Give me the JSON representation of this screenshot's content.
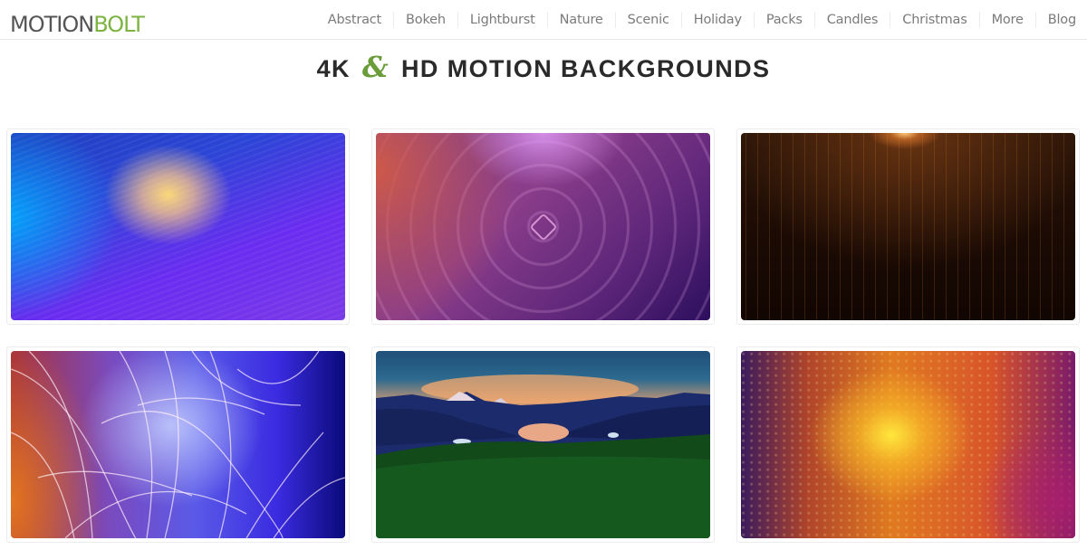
{
  "brand": {
    "logo_part1": "MOTION",
    "logo_part2": "BOLT",
    "accent_color": "#7cb342"
  },
  "nav": {
    "items": [
      {
        "label": "Abstract"
      },
      {
        "label": "Bokeh"
      },
      {
        "label": "Lightburst"
      },
      {
        "label": "Nature"
      },
      {
        "label": "Scenic"
      },
      {
        "label": "Holiday"
      },
      {
        "label": "Packs"
      },
      {
        "label": "Candles"
      },
      {
        "label": "Christmas"
      },
      {
        "label": "More"
      },
      {
        "label": "Blog"
      }
    ]
  },
  "hero": {
    "title_prefix": "4K",
    "title_amp": "&",
    "title_suffix": "HD MOTION BACKGROUNDS"
  },
  "gallery": {
    "items": [
      {
        "alt": "Blue and purple abstract background with yellow glow",
        "theme": "abstract"
      },
      {
        "alt": "Purple concentric rings background with center diamond",
        "theme": "rings"
      },
      {
        "alt": "Dark background with falling gold particles",
        "theme": "particles"
      },
      {
        "alt": "Colorful fireworks light streaks background",
        "theme": "fireworks"
      },
      {
        "alt": "Mountain lake landscape at sunset with green hills",
        "theme": "landscape"
      },
      {
        "alt": "Orange and yellow bokeh particle background",
        "theme": "bokeh"
      }
    ]
  }
}
